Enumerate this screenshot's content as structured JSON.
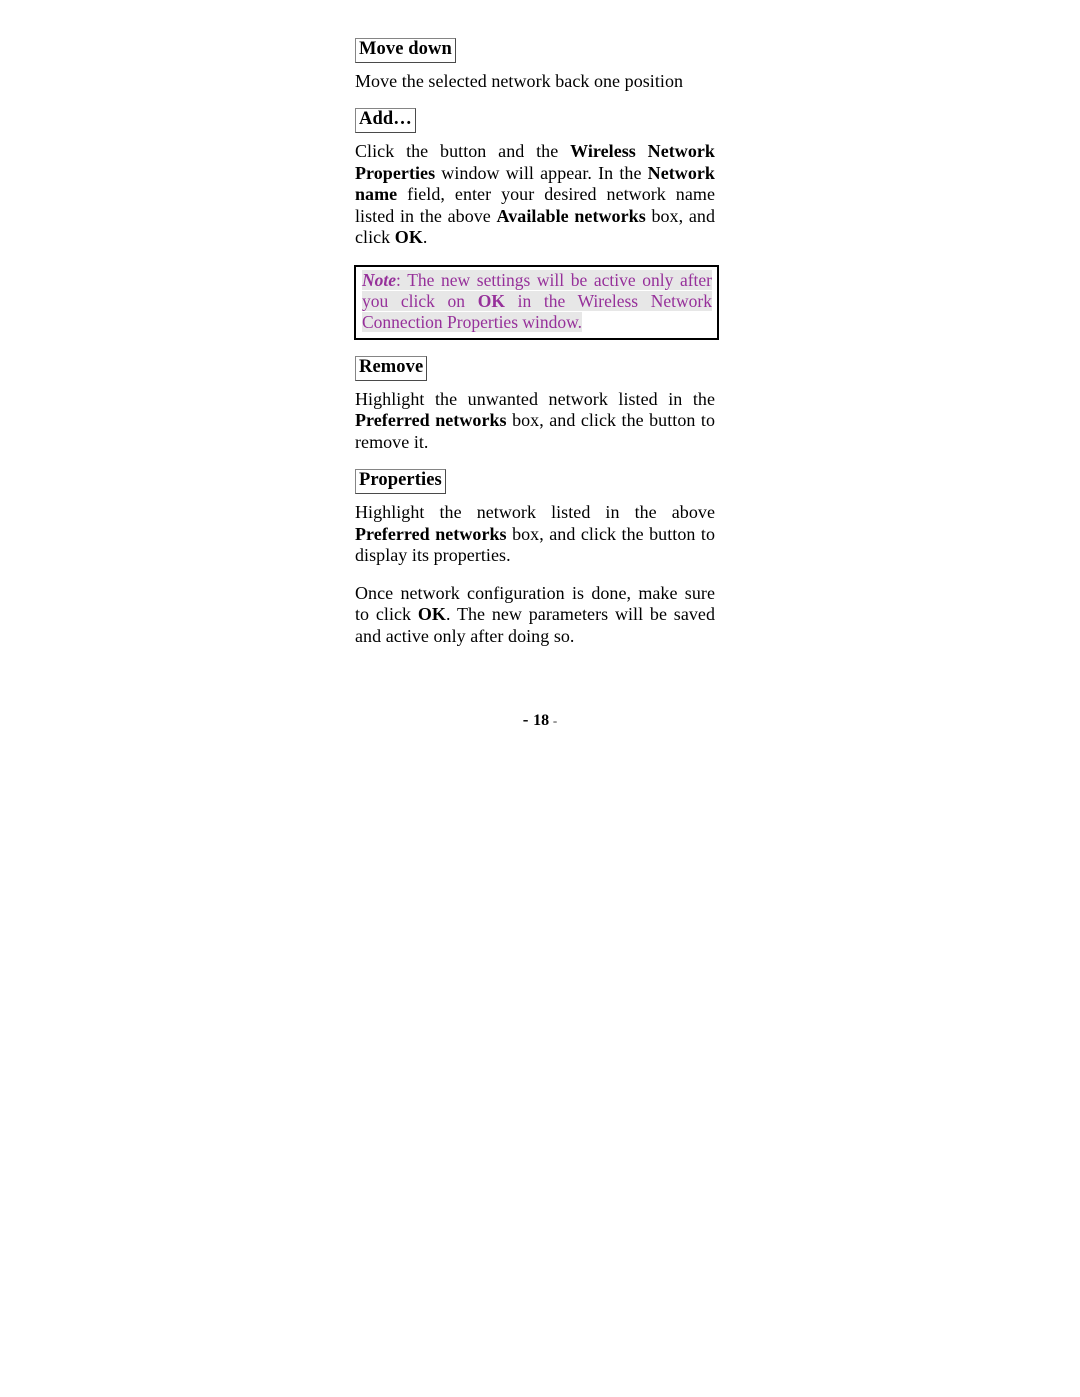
{
  "page": {
    "footer": {
      "dash_lead": "-",
      "number": "18",
      "dash_trail": "-"
    }
  },
  "sections": [
    {
      "heading": "Move down",
      "paragraphs": [
        {
          "runs": [
            {
              "text": "Move the selected network back one position",
              "bold": false
            }
          ]
        }
      ]
    },
    {
      "heading": "Add…",
      "paragraphs": [
        {
          "runs": [
            {
              "text": "Click the button and the ",
              "bold": false
            },
            {
              "text": "Wireless Network Properties",
              "bold": true
            },
            {
              "text": " window will appear.  In the ",
              "bold": false
            },
            {
              "text": "Network name",
              "bold": true
            },
            {
              "text": " field, enter your desired network name listed in the above ",
              "bold": false
            },
            {
              "text": "Available networks",
              "bold": true
            },
            {
              "text": " box, and click ",
              "bold": false
            },
            {
              "text": "OK",
              "bold": true
            },
            {
              "text": ".",
              "bold": false
            }
          ]
        }
      ]
    },
    {
      "heading": "Remove",
      "paragraphs": [
        {
          "runs": [
            {
              "text": "Highlight the unwanted network listed in the ",
              "bold": false
            },
            {
              "text": "Preferred networks",
              "bold": true
            },
            {
              "text": " box, and click the button to remove it.",
              "bold": false
            }
          ]
        }
      ]
    },
    {
      "heading": "Properties",
      "paragraphs": [
        {
          "runs": [
            {
              "text": "Highlight the network listed in the above ",
              "bold": false
            },
            {
              "text": "Preferred networks",
              "bold": true
            },
            {
              "text": " box, and click the button to display its properties.",
              "bold": false
            }
          ]
        },
        {
          "runs": [
            {
              "text": "Once network configuration is done, make sure to click ",
              "bold": false
            },
            {
              "text": "OK",
              "bold": true
            },
            {
              "text": ".  The new parameters will be saved and active only after doing so.",
              "bold": false
            }
          ]
        }
      ]
    }
  ],
  "note": {
    "label": "Note",
    "colon": ": ",
    "part1": "The new settings will be active only after you click on ",
    "emphasis": "OK",
    "part2": " in the Wireless Network Connection Properties window.",
    "text_color": "#96309A",
    "highlight_color": "#e7e7e7",
    "border_color": "#000000"
  }
}
